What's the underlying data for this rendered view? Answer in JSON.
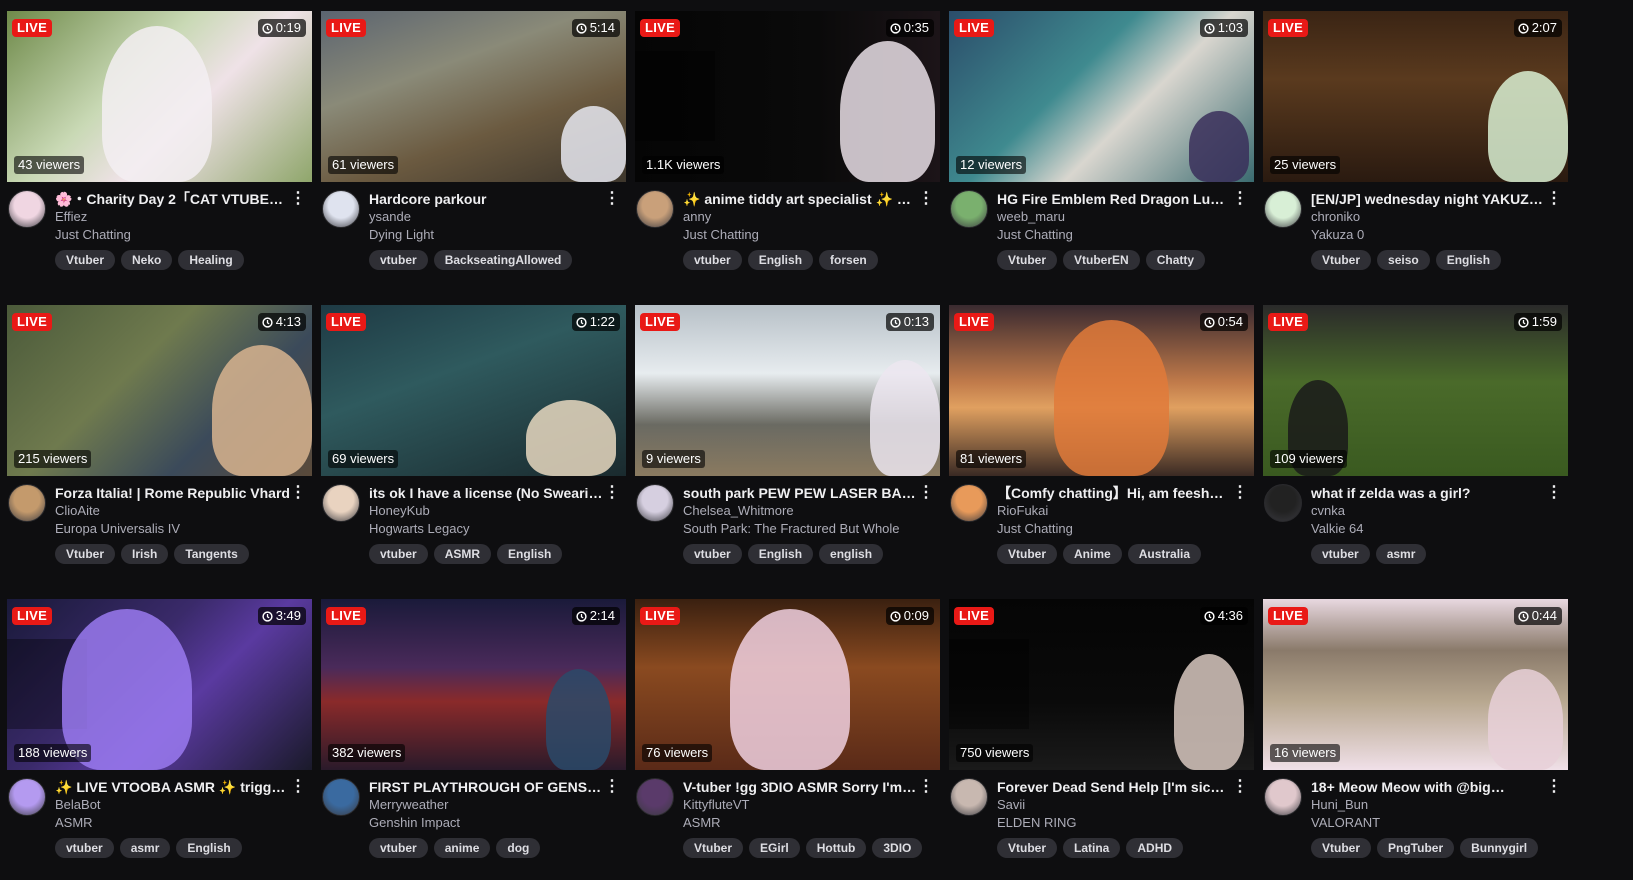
{
  "colors": {
    "live_badge": "#e91916",
    "tag_bg": "#2f2f35",
    "bg": "#0e0e10"
  },
  "icons": {
    "timer": "clock-icon",
    "more": "more-vertical-icon"
  },
  "live_label": "LIVE",
  "streams": [
    {
      "timer": "0:19",
      "viewers": "43 viewers",
      "title": "🌸・Charity Day 2「CAT VTUBER…",
      "channel": "Effiez",
      "category": "Just Chatting",
      "tags": [
        "Vtuber",
        "Neko",
        "Healing"
      ],
      "bg": "linear-gradient(135deg,#6f8a4a 0%,#c9d9b5 40%,#efe2e7 60%,#8fa66b 100%)",
      "fig": "#f3eef2",
      "av": "#f0d6e2"
    },
    {
      "timer": "5:14",
      "viewers": "61 viewers",
      "title": "Hardcore parkour",
      "channel": "ysande",
      "category": "Dying Light",
      "tags": [
        "vtuber",
        "BackseatingAllowed"
      ],
      "bg": "linear-gradient(160deg,#5b6470 0%,#8a8a78 35%,#6b5a40 65%,#3d362c 100%)",
      "fig": "#e6e8f0",
      "av": "#dfe3ef"
    },
    {
      "timer": "0:35",
      "viewers": "1.1K viewers",
      "title": "✨ anime tiddy art specialist ✨ gi…",
      "channel": "anny",
      "category": "Just Chatting",
      "tags": [
        "vtuber",
        "English",
        "forsen"
      ],
      "bg": "linear-gradient(90deg,#050505 0%,#0a0a0a 60%,#1c1418 100%)",
      "fig": "#e9dfe6",
      "av": "#c9a07a"
    },
    {
      "timer": "1:03",
      "viewers": "12 viewers",
      "title": "HG Fire Emblem Red Dragon Luna…",
      "channel": "weeb_maru",
      "category": "Just Chatting",
      "tags": [
        "Vtuber",
        "VtuberEN",
        "Chatty"
      ],
      "bg": "linear-gradient(135deg,#2b4d6a 0%,#3f8a8f 40%,#d9d6cf 60%,#3a6b70 100%)",
      "fig": "#3a2f5a",
      "av": "#7ab06e"
    },
    {
      "timer": "2:07",
      "viewers": "25 viewers",
      "title": "[EN/JP] wednesday night YAKUZ…",
      "channel": "chroniko",
      "category": "Yakuza 0",
      "tags": [
        "Vtuber",
        "seiso",
        "English"
      ],
      "bg": "linear-gradient(180deg,#3a2414 0%,#5a3a1e 40%,#2a1a10 100%)",
      "fig": "#d9f0d2",
      "av": "#d8efd6"
    },
    {
      "timer": "4:13",
      "viewers": "215 viewers",
      "title": "Forza Italia! | Rome Republic Vhard",
      "channel": "ClioAite",
      "category": "Europa Universalis IV",
      "tags": [
        "Vtuber",
        "Irish",
        "Tangents"
      ],
      "bg": "linear-gradient(135deg,#4b5a3a 0%,#6f7a4e 40%,#3b4a5a 70%,#5a4a3a 100%)",
      "fig": "#d8b48f",
      "av": "#c49a6c"
    },
    {
      "timer": "1:22",
      "viewers": "69 viewers",
      "title": "its ok I have a license (No Swearin…",
      "channel": "HoneyKub",
      "category": "Hogwarts Legacy",
      "tags": [
        "vtuber",
        "ASMR",
        "English"
      ],
      "bg": "linear-gradient(160deg,#1e3a44 0%,#2f5a5e 40%,#1a2a2e 100%)",
      "fig": "#e8d8c0",
      "av": "#e9d3c0"
    },
    {
      "timer": "0:13",
      "viewers": "9 viewers",
      "title": "south park PEW PEW LASER BAM …",
      "channel": "Chelsea_Whitmore",
      "category": "South Park: The Fractured But Whole",
      "tags": [
        "vtuber",
        "English",
        "english"
      ],
      "bg": "linear-gradient(180deg,#b7c0c7 0%,#e7ecef 40%,#6a6a62 70%,#8a7a60 100%)",
      "fig": "#ece6f0",
      "av": "#d6cfe0"
    },
    {
      "timer": "0:54",
      "viewers": "81 viewers",
      "title": "【Comfy chatting】Hi, am feesh【…",
      "channel": "RioFukai",
      "category": "Just Chatting",
      "tags": [
        "Vtuber",
        "Anime",
        "Australia"
      ],
      "bg": "linear-gradient(180deg,#3a2a30 0%,#c07a4a 45%,#e0a060 60%,#3a2a24 100%)",
      "fig": "#e07a3a",
      "av": "#e89a5a"
    },
    {
      "timer": "1:59",
      "viewers": "109 viewers",
      "title": "what if zelda was a girl?",
      "channel": "cvnka",
      "category": "Valkie 64",
      "tags": [
        "vtuber",
        "asmr"
      ],
      "bg": "linear-gradient(180deg,#2a2a2a 0%,#4a6a2a 45%,#3a5a20 100%)",
      "fig": "#1a1a1a",
      "av": "#222222"
    },
    {
      "timer": "3:49",
      "viewers": "188 viewers",
      "title": "✨ LIVE VTOOBA ASMR ✨ trigger …",
      "channel": "BelaBot",
      "category": "ASMR",
      "tags": [
        "vtuber",
        "asmr",
        "English"
      ],
      "bg": "linear-gradient(135deg,#1a1a3a 0%,#3a2a6a 40%,#5a3aa0 60%,#1a1a2a 100%)",
      "fig": "#9a7af0",
      "av": "#b49af0"
    },
    {
      "timer": "2:14",
      "viewers": "382 viewers",
      "title": "FIRST PLAYTHROUGH OF GENSHI…",
      "channel": "Merryweather",
      "category": "Genshin Impact",
      "tags": [
        "vtuber",
        "anime",
        "dog"
      ],
      "bg": "linear-gradient(180deg,#1a1a3a 0%,#4a2a5a 40%,#8a2a2a 60%,#2a1a2a 100%)",
      "fig": "#2a4a6a",
      "av": "#3a6aa0"
    },
    {
      "timer": "0:09",
      "viewers": "76 viewers",
      "title": "V-tuber !gg 3DIO ASMR Sorry I'm l…",
      "channel": "KittyfluteVT",
      "category": "ASMR",
      "tags": [
        "Vtuber",
        "EGirl",
        "Hottub",
        "3DIO"
      ],
      "bg": "linear-gradient(180deg,#3a2010 0%,#8a4a20 40%,#5a2a18 100%)",
      "fig": "#f0d0e0",
      "av": "#5a3a6a"
    },
    {
      "timer": "4:36",
      "viewers": "750 viewers",
      "title": "Forever Dead Send Help [I'm sick]…",
      "channel": "Savii",
      "category": "ELDEN RING",
      "tags": [
        "Vtuber",
        "Latina",
        "ADHD"
      ],
      "bg": "linear-gradient(180deg,#050505 0%,#0a0a0a 60%,#1a1a1a 100%)",
      "fig": "#d8c8c0",
      "av": "#c8b8b0"
    },
    {
      "timer": "0:44",
      "viewers": "16 viewers",
      "title": "18+ Meow Meow with @big…",
      "channel": "Huni_Bun",
      "category": "VALORANT",
      "tags": [
        "Vtuber",
        "PngTuber",
        "Bunnygirl"
      ],
      "bg": "linear-gradient(180deg,#e8d8e0 0%,#8a7a6a 30%,#b8a890 60%,#f0e0e8 100%)",
      "fig": "#e8d0d8",
      "av": "#e0c8cc"
    }
  ]
}
